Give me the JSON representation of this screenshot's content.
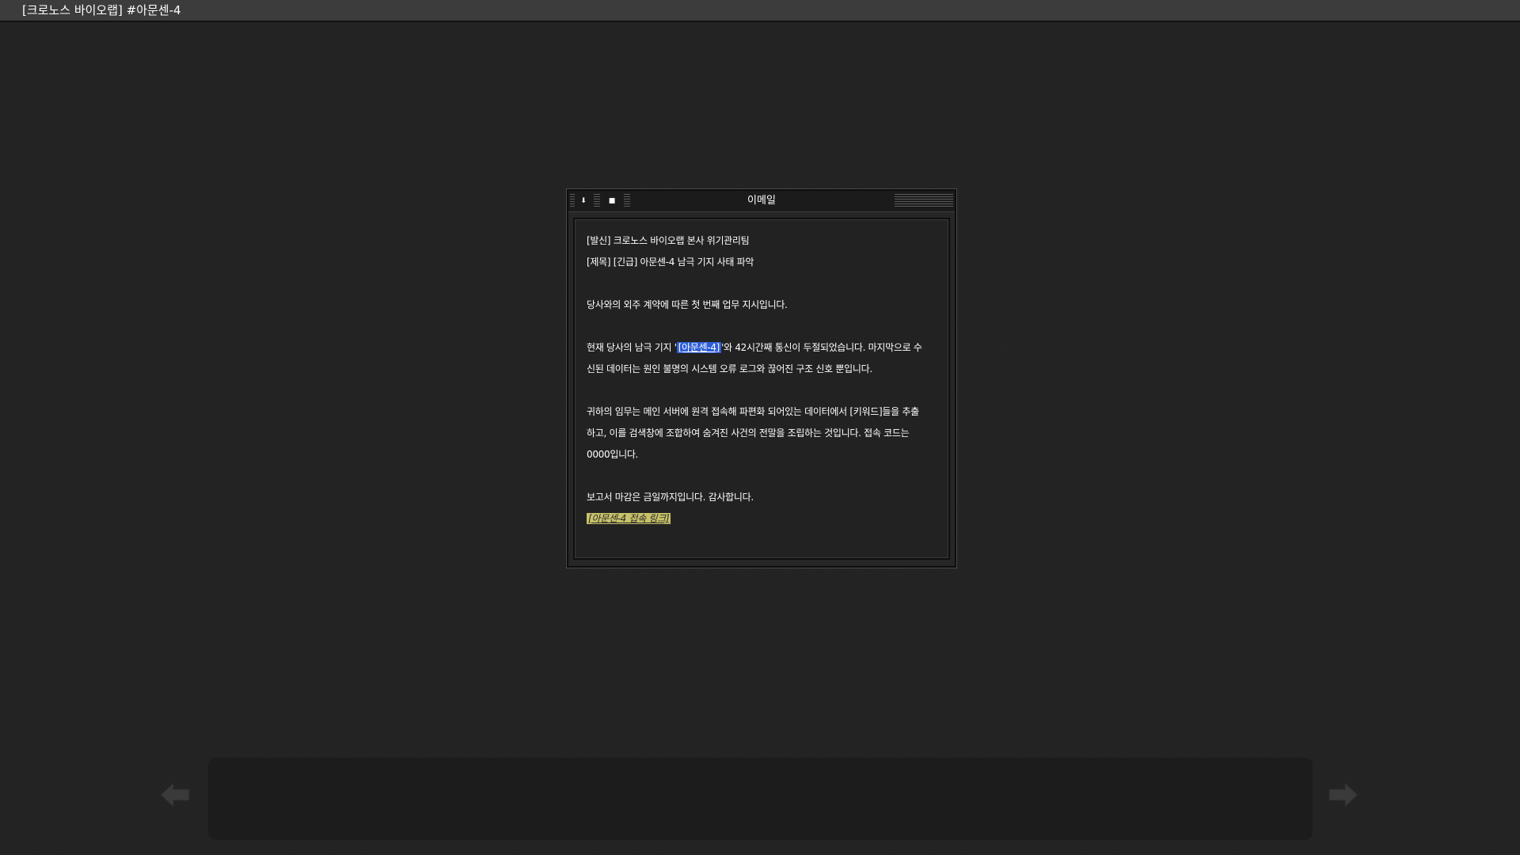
{
  "window": {
    "title": "[크로노스 바이오랩] #아문센-4"
  },
  "email": {
    "title": "이메일",
    "minimize_glyph": "⬇",
    "close_glyph": "■",
    "sender_line": "[발신] 크로노스 바이오랩 본사 위기관리팀",
    "subject_line": "[제목] [긴급] 아문센-4 남극 기지 사태 파악",
    "para1": "당사와의 외주 계약에 따른 첫 번째 업무 지시입니다.",
    "para2_before": "현재 당사의 남극 기지 '",
    "para2_link": "[아문센-4]",
    "para2_after": "'와 42시간째 통신이 두절되었습니다. 마지막으로 수",
    "para2_line2": "신된 데이터는 원인 불명의 시스템 오류 로그와 끊어진 구조 신호 뿐입니다.",
    "para3_line1": "귀하의 임무는 메인 서버에 원격 접속해 파편화 되어있는 데이터에서 [키워드]들을 추출",
    "para3_line2": "하고, 이를 검색창에 조합하여 숨겨진 사건의 전말을 조립하는 것입니다. 접속 코드는",
    "para3_line3": "0000입니다.",
    "closing": "보고서 마감은 금일까지입니다. 감사합니다.",
    "access_link": "[아문센-4 접속 링크]"
  },
  "colors": {
    "background": "#222222",
    "link_highlight": "#2e5ed6",
    "yellow_link": "#c9c26a"
  },
  "nav": {
    "prev_icon": "left-arrow-icon",
    "next_icon": "right-arrow-icon"
  }
}
